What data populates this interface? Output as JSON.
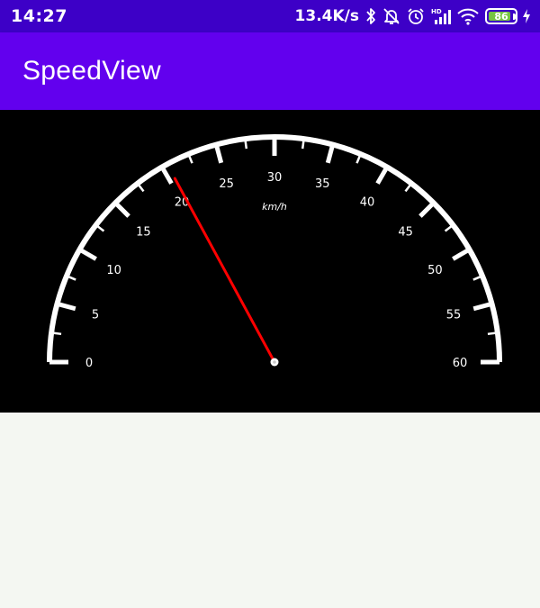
{
  "status_bar": {
    "time": "14:27",
    "network_speed": "13.4K/s",
    "battery_level": "86",
    "icons": [
      "bluetooth-icon",
      "alarm-off-icon",
      "alarm-clock-icon",
      "hd-signal-icon",
      "wifi-icon",
      "battery-icon",
      "charging-icon"
    ]
  },
  "app_bar": {
    "title": "SpeedView"
  },
  "speedometer": {
    "min": 0,
    "max": 60,
    "current_speed": 20.5,
    "unit": "km/h",
    "major_ticks": [
      "0",
      "5",
      "10",
      "15",
      "20",
      "25",
      "30",
      "35",
      "40",
      "45",
      "50",
      "55",
      "60"
    ],
    "colors": {
      "background": "#000000",
      "arc": "#ffffff",
      "needle": "#ff0000",
      "text": "#ffffff"
    }
  },
  "colors": {
    "status_bar": "#3d00c7",
    "app_bar": "#6200ee",
    "content_background": "#f4f7f2"
  }
}
